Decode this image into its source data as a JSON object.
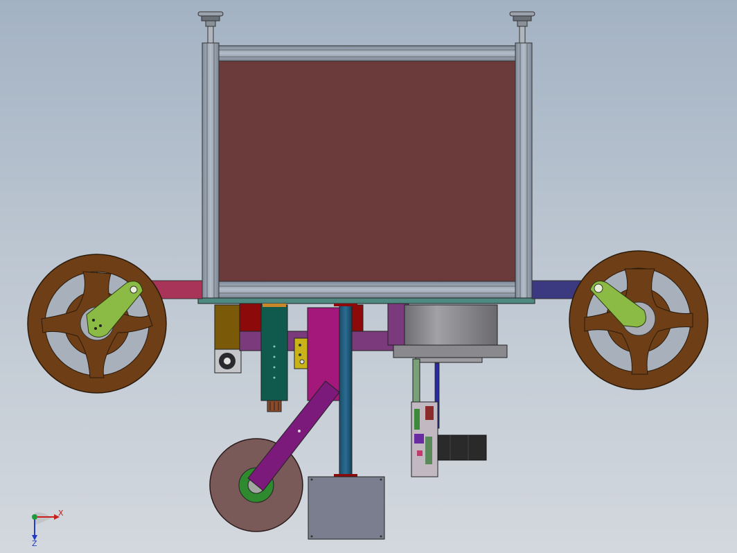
{
  "viewport": {
    "background_top": "#a3b2c3",
    "background_bottom": "#d3d8de"
  },
  "colors": {
    "frame": "#9aa6b4",
    "panel": "#6b3a3a",
    "wheel": "#6e3f17",
    "crank": "#8bbb45",
    "hub": "#a8acb4",
    "left_arm": "#a8345a",
    "right_arm": "#3b3a80",
    "disc": "#7a5a58",
    "link": "#7b1a7b",
    "post": "#1b5878",
    "motor": "#7a7e8e",
    "drum": "#8c8c90",
    "magenta_block": "#a3187a",
    "stepper": "#2a2a2a",
    "mount_plate": "#4f8a82"
  },
  "triad": {
    "x_label": "X",
    "z_label": "Z",
    "x_color": "#c81e1e",
    "z_color": "#1e3cc8",
    "origin_color": "#1e9a3c"
  }
}
